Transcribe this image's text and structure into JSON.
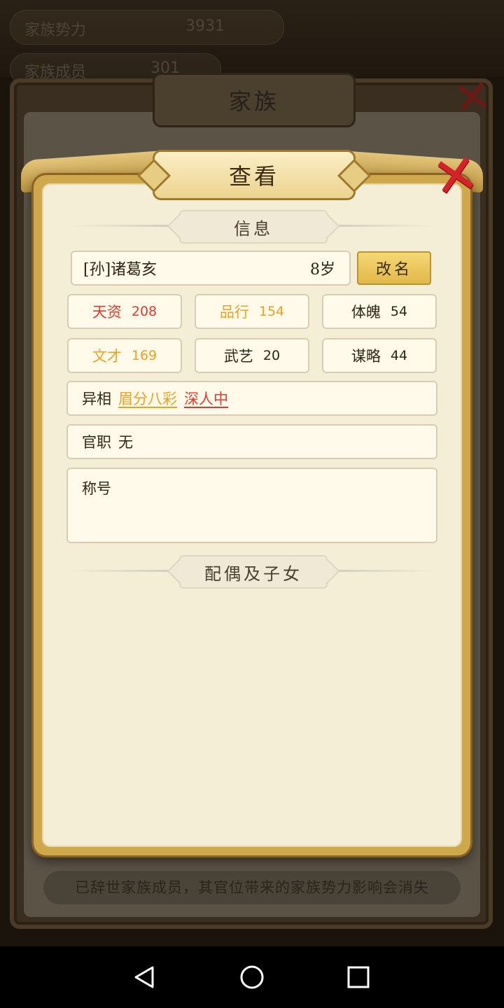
{
  "background": {
    "top_bar_text": "家族势力",
    "top_bar_value": "3931",
    "second_bar_text": "家族成员",
    "second_bar_value": "301",
    "back_window_title": "家族",
    "footer_notice": "已辞世家族成员，其官位带来的家族势力影响会消失"
  },
  "dialog": {
    "title": "查看",
    "close_icon": "close-x-icon",
    "section_info": "信息",
    "person": {
      "name": "[孙]诸葛亥",
      "age": "8岁",
      "rename_button": "改名"
    },
    "stats": [
      {
        "label": "天资",
        "value": "208",
        "color": "#e23b2e"
      },
      {
        "label": "品行",
        "value": "154",
        "color": "#f0a020"
      },
      {
        "label": "体魄",
        "value": "54",
        "color": "#2f2618"
      },
      {
        "label": "文才",
        "value": "169",
        "color": "#f0a020"
      },
      {
        "label": "武艺",
        "value": "20",
        "color": "#2f2618"
      },
      {
        "label": "谋略",
        "value": "44",
        "color": "#2f2618"
      }
    ],
    "traits": {
      "label": "异相",
      "items": [
        {
          "text": "眉分八彩",
          "color": "#f0a020"
        },
        {
          "text": "深人中",
          "color": "#e23b2e"
        }
      ]
    },
    "office": {
      "label": "官职",
      "value": "无"
    },
    "honor": {
      "label": "称号",
      "value": ""
    },
    "section_family": "配偶及子女"
  },
  "navbar": {
    "back": "back-triangle-icon",
    "home": "home-circle-icon",
    "recents": "recents-square-icon"
  }
}
